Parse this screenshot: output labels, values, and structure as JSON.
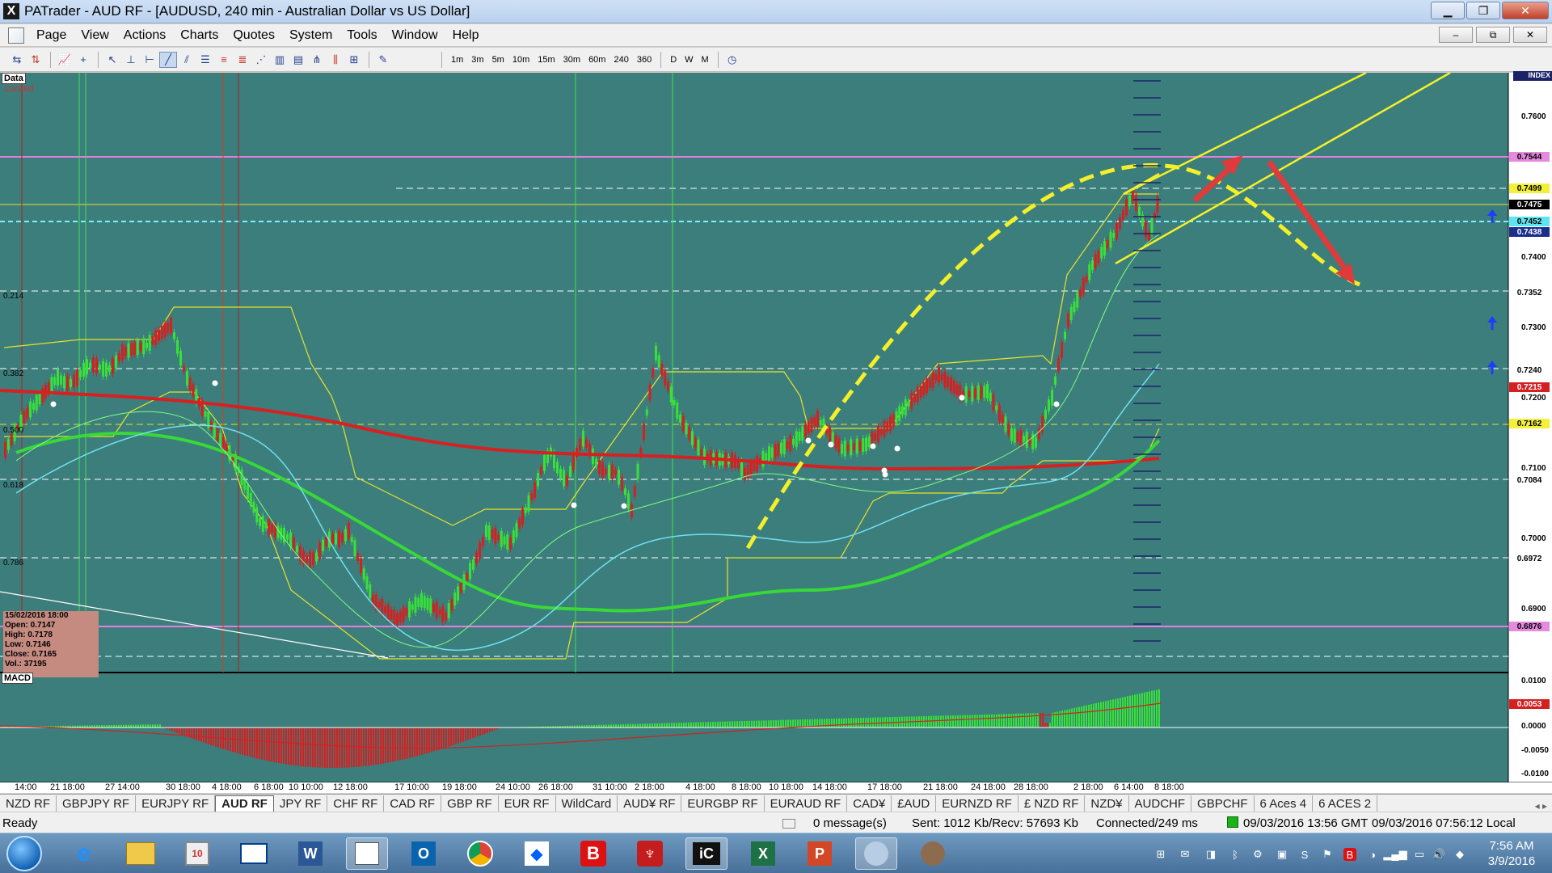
{
  "window": {
    "title": "PATrader - AUD RF - [AUDUSD, 240 min - Australian Dollar vs US Dollar]",
    "app_icon": "X"
  },
  "menu": [
    "Page",
    "View",
    "Actions",
    "Charts",
    "Quotes",
    "System",
    "Tools",
    "Window",
    "Help"
  ],
  "toolbar": {
    "timeframes": [
      "1m",
      "3m",
      "5m",
      "10m",
      "15m",
      "30m",
      "60m",
      "240",
      "360",
      "D",
      "W",
      "M"
    ]
  },
  "chart": {
    "data_label": "Data",
    "locked_label": "Locked",
    "macd_label": "MACD",
    "index_label": "INDEX",
    "fib_labels": [
      "0.214",
      "0.382",
      "0.500",
      "0.618",
      "0.786"
    ],
    "price_axis": [
      "0.7600",
      "0.7400",
      "0.7300",
      "0.7200",
      "0.7100",
      "0.7000",
      "0.6900"
    ],
    "price_tags": [
      {
        "label": "0.7544",
        "bg": "#e48be0",
        "fg": "#000"
      },
      {
        "label": "0.7499",
        "bg": "#f4f03a",
        "fg": "#000"
      },
      {
        "label": "0.7475",
        "bg": "#000000",
        "fg": "#ffffff"
      },
      {
        "label": "0.7452",
        "bg": "#5fe4f1",
        "fg": "#000"
      },
      {
        "label": "0.7438",
        "bg": "#1b2e8c",
        "fg": "#ffffff"
      },
      {
        "label": "0.7352",
        "bg": "#ffffff",
        "fg": "#000"
      },
      {
        "label": "0.7240",
        "bg": "#ffffff",
        "fg": "#000"
      },
      {
        "label": "0.7215",
        "bg": "#d42020",
        "fg": "#ffffff"
      },
      {
        "label": "0.7162",
        "bg": "#f4f03a",
        "fg": "#000"
      },
      {
        "label": "0.7084",
        "bg": "#ffffff",
        "fg": "#000"
      },
      {
        "label": "0.6972",
        "bg": "#ffffff",
        "fg": "#000"
      },
      {
        "label": "0.6876",
        "bg": "#e48be0",
        "fg": "#000"
      }
    ],
    "macd_axis": [
      "0.0100",
      "0.0053",
      "0.0000",
      "-0.0050",
      "-0.0100"
    ],
    "macd_tag": {
      "label": "0.0053",
      "bg": "#d42020",
      "fg": "#ffffff"
    },
    "time_labels": [
      "14:00",
      "21 18:00",
      "27 14:00",
      "30 18:00",
      "4 18:00",
      "6 18:00",
      "10 10:00",
      "12 18:00",
      "17 10:00",
      "19 18:00",
      "24 10:00",
      "26 18:00",
      "31 10:00",
      "2 18:00",
      "4 18:00",
      "8 18:00",
      "10 18:00",
      "14 18:00",
      "17 18:00",
      "21 18:00",
      "24 18:00",
      "28 18:00",
      "2 18:00",
      "6 14:00",
      "8 18:00"
    ],
    "info_box": {
      "date": "15/02/2016 18:00",
      "open": "Open: 0.7147",
      "high": "High: 0.7178",
      "low": "Low: 0.7146",
      "close": "Close: 0.7165",
      "vol": "Vol.: 37195"
    }
  },
  "symbol_tabs": [
    "NZD RF",
    "GBPJPY RF",
    "EURJPY RF",
    "AUD RF",
    "JPY RF",
    "CHF RF",
    "CAD RF",
    "GBP RF",
    "EUR RF",
    "WildCard",
    "AUD¥ RF",
    "EURGBP RF",
    "EURAUD RF",
    "CAD¥",
    "£AUD",
    "EURNZD RF",
    "£ NZD RF",
    "NZD¥",
    "AUDCHF",
    "GBPCHF",
    "6 Aces 4",
    "6 ACES 2"
  ],
  "active_tab": "AUD RF",
  "status": {
    "ready": "Ready",
    "messages": "0 message(s)",
    "traffic": "Sent: 1012 Kb/Recv: 57693 Kb",
    "connection": "Connected/249 ms",
    "gmt": "09/03/2016 13:56 GMT",
    "local": "09/03/2016 07:56:12 Local"
  },
  "taskbar": {
    "time": "7:56 AM",
    "date": "3/9/2016"
  }
}
